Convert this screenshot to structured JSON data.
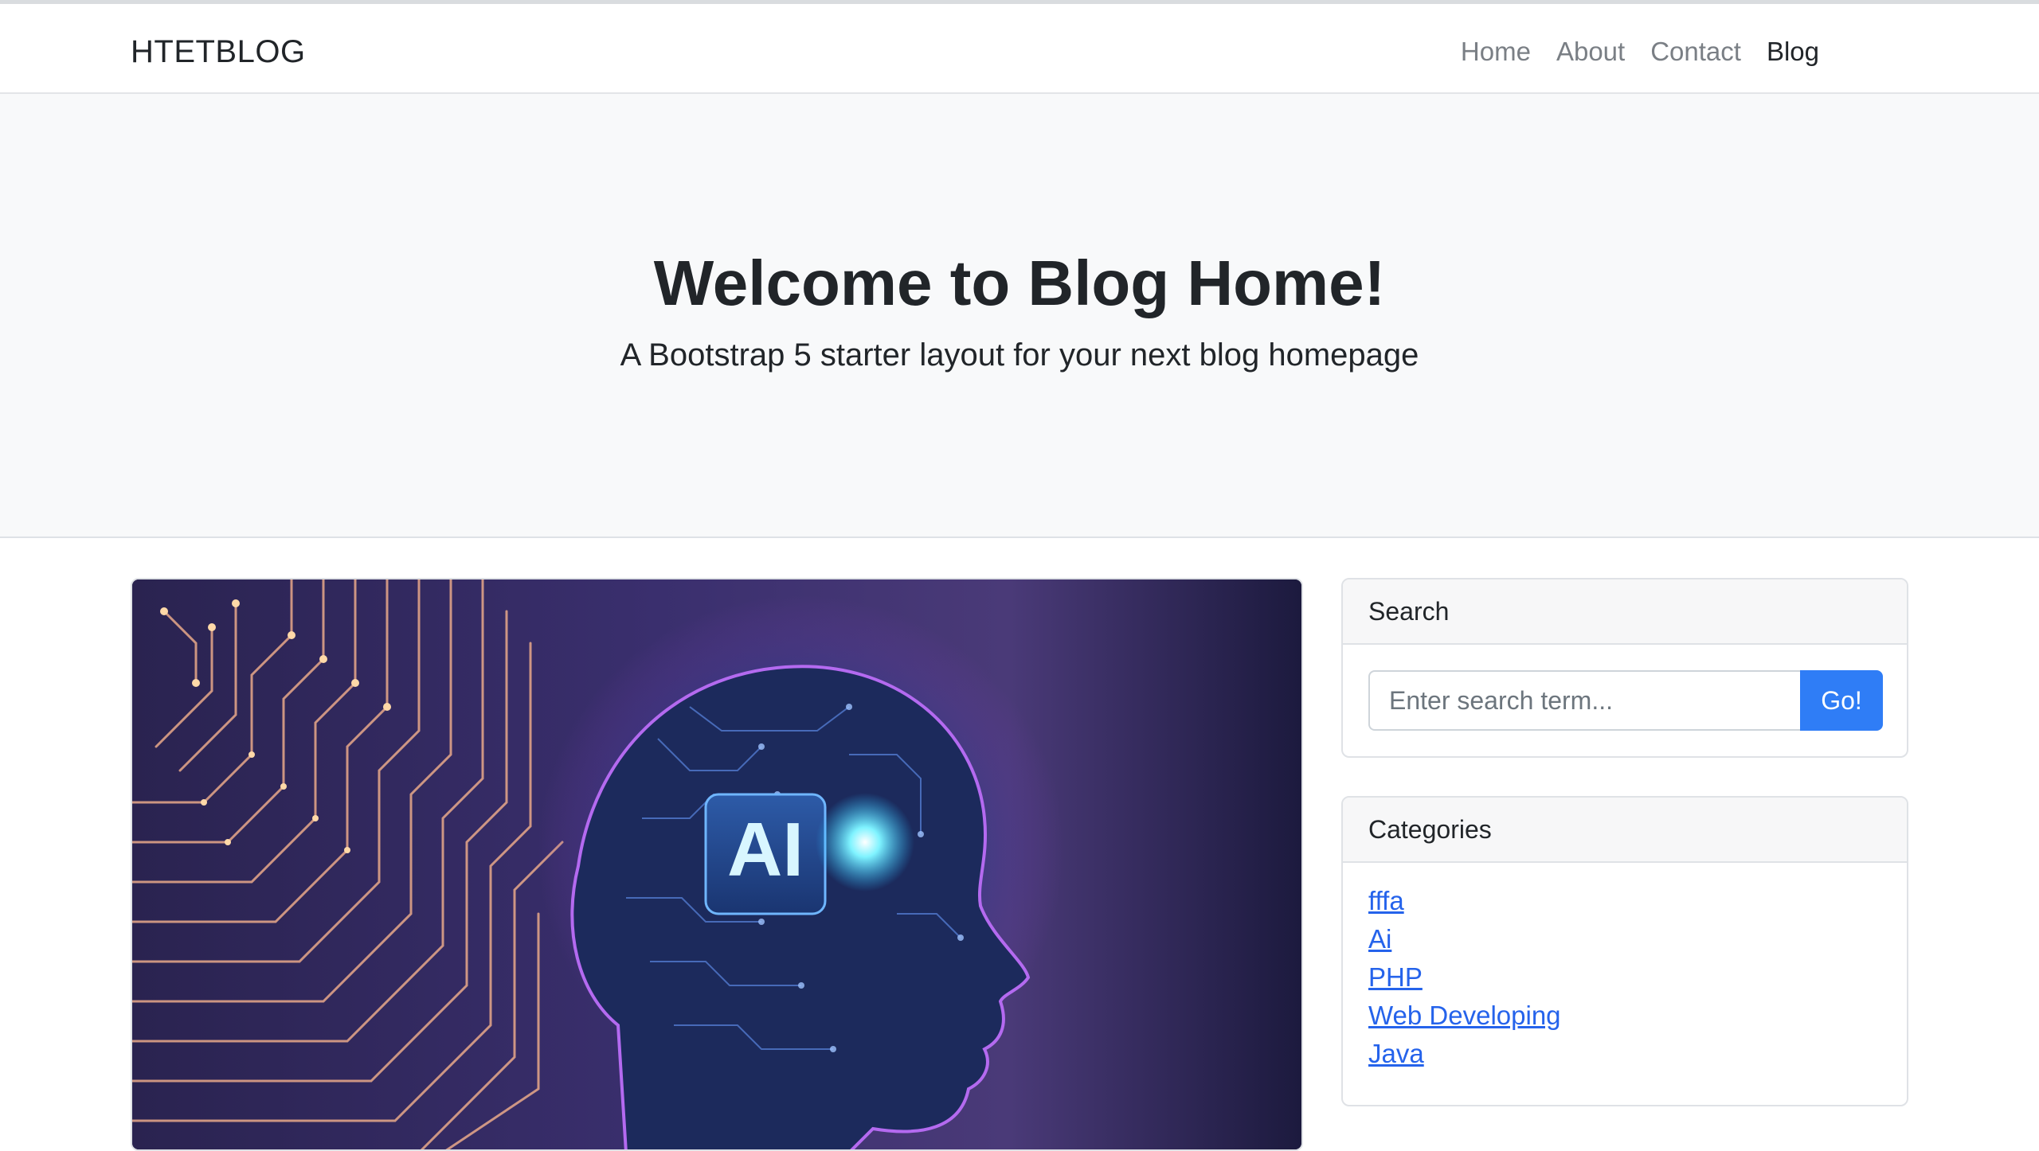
{
  "navbar": {
    "brand": "HTETBLOG",
    "links": [
      {
        "label": "Home"
      },
      {
        "label": "About"
      },
      {
        "label": "Contact"
      },
      {
        "label": "Blog"
      }
    ]
  },
  "hero": {
    "title": "Welcome to Blog Home!",
    "subtitle": "A Bootstrap 5 starter layout for your next blog homepage"
  },
  "featured_post": {
    "image_text": "AI"
  },
  "sidebar": {
    "search": {
      "header": "Search",
      "placeholder": "Enter search term...",
      "value": "",
      "button_label": "Go!"
    },
    "categories": {
      "header": "Categories",
      "items": [
        {
          "label": "fffa"
        },
        {
          "label": "Ai"
        },
        {
          "label": "PHP"
        },
        {
          "label": "Web Developing"
        },
        {
          "label": "Java"
        }
      ]
    }
  },
  "colors": {
    "primary": "#2f7df6",
    "link": "#2563eb",
    "hero_bg": "#f8f9fa"
  }
}
